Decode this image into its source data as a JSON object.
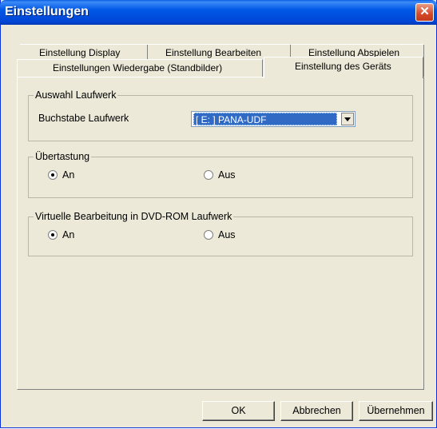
{
  "window": {
    "title": "Einstellungen"
  },
  "tabs_back": [
    "Einstellung Display",
    "Einstellung Bearbeiten",
    "Einstellung Abspielen"
  ],
  "tabs_front": [
    "Einstellungen Wiedergabe (Standbilder)",
    "Einstellung des Geräts"
  ],
  "drive": {
    "group_title": "Auswahl Laufwerk",
    "label": "Buchstabe Laufwerk",
    "selected": "[ E: ] PANA-UDF"
  },
  "overscan": {
    "group_title": "Übertastung",
    "on_label": "An",
    "off_label": "Aus",
    "selected": "An"
  },
  "virtual_edit": {
    "group_title": "Virtuelle Bearbeitung in DVD-ROM Laufwerk",
    "on_label": "An",
    "off_label": "Aus",
    "selected": "An"
  },
  "buttons": {
    "ok": "OK",
    "cancel": "Abbrechen",
    "apply": "Übernehmen"
  }
}
